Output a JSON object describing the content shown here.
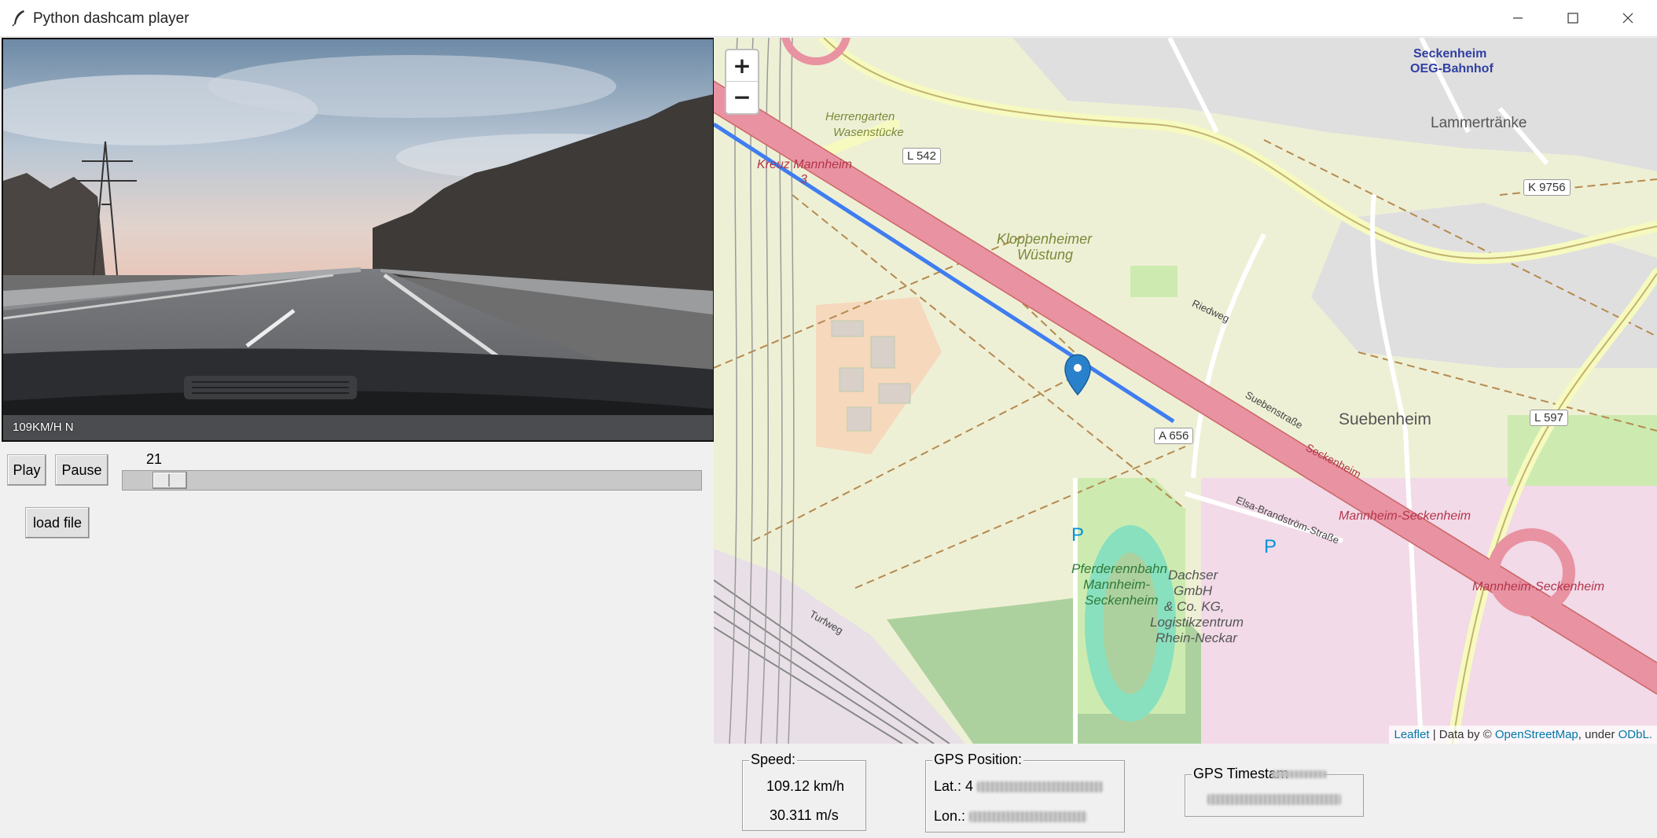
{
  "window": {
    "title": "Python dashcam player"
  },
  "video": {
    "overlay_text": "109KM/H  N"
  },
  "controls": {
    "play_label": "Play",
    "pause_label": "Pause",
    "load_label": "load file",
    "slider_value": "21",
    "slider_position": 0.04
  },
  "map": {
    "zoom_in": "+",
    "zoom_out": "−",
    "attribution": {
      "leaflet": "Leaflet",
      "sep": " | Data by © ",
      "osm": "OpenStreetMap",
      "under": ", under ",
      "odbl": "ODbL."
    },
    "labels": {
      "seckenheim": "Seckenheim",
      "oeg": "OEG-Bahnhof",
      "laemmer": "Lammertränke",
      "herrengarten": "Herrengarten",
      "wasen": "Wasenstücke",
      "kreuz": "Kreuz Mannheim",
      "kreuz_num": "3",
      "klopp1": "Kloppenheimer",
      "klopp2": "Wüstung",
      "suebenheim": "Suebenheim",
      "mannheim_seck1": "Mannheim-Seckenheim",
      "mannheim_seck2": "Mannheim-Seckenheim",
      "pferd1": "Pferderennbahn",
      "pferd2": "Mannheim-",
      "pferd3": "Seckenheim",
      "dachser1": "Dachser",
      "dachser2": "GmbH",
      "dachser3": "& Co. KG,",
      "dachser4": "Logistikzentrum",
      "dachser5": "Rhein-Neckar",
      "riedweg": "Riedweg",
      "turfweg": "Turfweg",
      "elsa": "Elsa-Brandström-Straße",
      "sueben_str": "Suebenstraße",
      "seckenheim_str": "Seckenheim"
    },
    "shields": {
      "l542": "L 542",
      "k9756": "K 9756",
      "a656": "A 656",
      "l597": "L 597"
    },
    "colors": {
      "route": "#3f7df0",
      "motorway": "#e892a2",
      "marker": "#2a81cb"
    }
  },
  "info": {
    "speed_title": "Speed:",
    "speed_kmh": "109.12 km/h",
    "speed_ms": "30.311 m/s",
    "gps_title": "GPS Position:",
    "lat_label": "Lat.: 4",
    "lon_label": "Lon.:",
    "ts_title": "GPS Timestam"
  }
}
